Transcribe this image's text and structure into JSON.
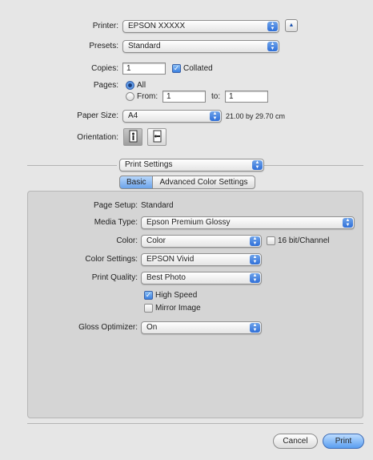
{
  "printer": {
    "label": "Printer:",
    "value": "EPSON XXXXX"
  },
  "presets": {
    "label": "Presets:",
    "value": "Standard"
  },
  "copies": {
    "label": "Copies:",
    "value": "1",
    "collated_label": "Collated"
  },
  "pages": {
    "label": "Pages:",
    "all_label": "All",
    "from_label": "From:",
    "from_value": "1",
    "to_label": "to:",
    "to_value": "1"
  },
  "paper_size": {
    "label": "Paper Size:",
    "value": "A4",
    "dimensions": "21.00 by 29.70 cm"
  },
  "orientation": {
    "label": "Orientation:"
  },
  "section_popup": {
    "value": "Print Settings"
  },
  "tabs": [
    {
      "label": "Basic"
    },
    {
      "label": "Advanced Color Settings"
    }
  ],
  "page_setup": {
    "label": "Page Setup:",
    "value": "Standard"
  },
  "media_type": {
    "label": "Media Type:",
    "value": "Epson Premium Glossy"
  },
  "color": {
    "label": "Color:",
    "value": "Color",
    "bit_label": "16 bit/Channel"
  },
  "color_settings": {
    "label": "Color Settings:",
    "value": "EPSON Vivid"
  },
  "print_quality": {
    "label": "Print Quality:",
    "value": "Best Photo"
  },
  "high_speed": {
    "label": "High Speed"
  },
  "mirror_image": {
    "label": "Mirror Image"
  },
  "gloss_optimizer": {
    "label": "Gloss Optimizer:",
    "value": "On"
  },
  "buttons": {
    "cancel": "Cancel",
    "print": "Print"
  },
  "colors": {
    "accent": "#3a7fe0",
    "background": "#e6e6e6"
  }
}
